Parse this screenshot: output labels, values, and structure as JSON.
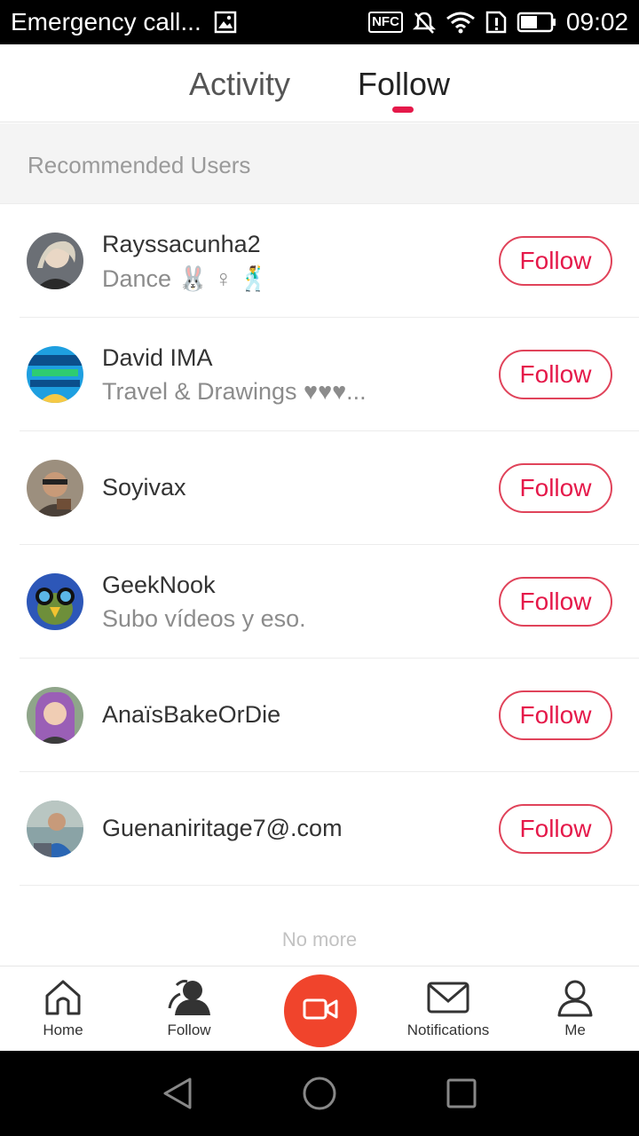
{
  "status_bar": {
    "left_text": "Emergency call...",
    "nfc_label": "NFC",
    "time": "09:02",
    "icons": [
      "image-icon",
      "nfc-icon",
      "mute-icon",
      "wifi-icon",
      "sim-alert-icon",
      "battery-icon"
    ]
  },
  "top_tabs": {
    "activity": "Activity",
    "follow": "Follow",
    "active": "follow",
    "indicator_color": "#e5194a"
  },
  "section": {
    "title": "Recommended Users"
  },
  "users": [
    {
      "name": "Rayssacunha2",
      "bio": "Dance 🐰 ♀ 🕺",
      "button": "Follow"
    },
    {
      "name": "David IMA",
      "bio": "Travel & Drawings  ♥♥♥...",
      "button": "Follow"
    },
    {
      "name": "Soyivax",
      "bio": "",
      "button": "Follow"
    },
    {
      "name": "GeekNook",
      "bio": "Subo vídeos y eso.",
      "button": "Follow"
    },
    {
      "name": "AnaïsBakeOrDie",
      "bio": "",
      "button": "Follow"
    },
    {
      "name": "Guenaniritage7@.com",
      "bio": "",
      "button": "Follow"
    }
  ],
  "footer": {
    "no_more": "No more"
  },
  "bottom_nav": {
    "home": "Home",
    "follow": "Follow",
    "notifications": "Notifications",
    "me": "Me",
    "record_color": "#f0442c"
  },
  "colors": {
    "accent": "#e5194a",
    "follow_border": "#e0435a"
  }
}
